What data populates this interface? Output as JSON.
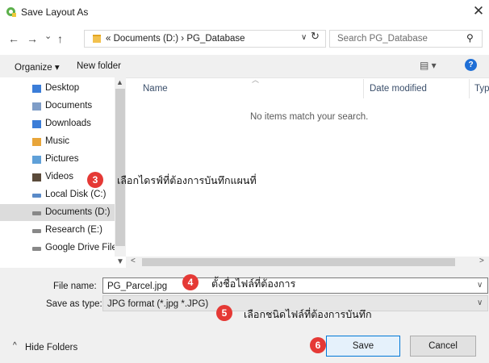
{
  "window": {
    "title": "Save Layout As",
    "close_glyph": "✕"
  },
  "nav": {
    "back": "←",
    "forward": "→",
    "recent": "⌄",
    "up": "↑"
  },
  "address": {
    "path": "«  Documents (D:)  ›  PG_Database",
    "dropdown": "∨",
    "refresh": "↻"
  },
  "search": {
    "placeholder": "Search PG_Database",
    "icon": "⚲"
  },
  "toolbar": {
    "organize": "Organize ▾",
    "new_folder": "New folder",
    "view_glyph": "▤ ▾",
    "help": "?"
  },
  "sidebar": {
    "items": [
      {
        "label": "Desktop",
        "icon": "folder-icon",
        "color": "#3b7dd8"
      },
      {
        "label": "Documents",
        "icon": "documents-icon",
        "color": "#7f9dc7"
      },
      {
        "label": "Downloads",
        "icon": "downloads-icon",
        "color": "#3b7dd8"
      },
      {
        "label": "Music",
        "icon": "music-icon",
        "color": "#e8a53a"
      },
      {
        "label": "Pictures",
        "icon": "pictures-icon",
        "color": "#5fa0d8"
      },
      {
        "label": "Videos",
        "icon": "videos-icon",
        "color": "#5a4a3a"
      },
      {
        "label": "Local Disk (C:)",
        "icon": "drive-icon",
        "color": "#5a8ac8"
      },
      {
        "label": "Documents (D:)",
        "icon": "drive-icon",
        "color": "#888888"
      },
      {
        "label": "Research (E:)",
        "icon": "drive-icon",
        "color": "#888888"
      },
      {
        "label": "Google Drive File",
        "icon": "drive-icon",
        "color": "#888888"
      }
    ],
    "selected": "Documents (D:)"
  },
  "columns": {
    "name": "Name",
    "date": "Date modified",
    "type": "Typ"
  },
  "empty_message": "No items match your search.",
  "form": {
    "file_name_label": "File name:",
    "file_name_value": "PG_Parcel.jpg",
    "save_type_label": "Save as type:",
    "save_type_value": "JPG format (*.jpg *.JPG)"
  },
  "footer": {
    "hide_folders": "Hide Folders",
    "save": "Save",
    "cancel": "Cancel"
  },
  "annotations": [
    {
      "number": "3",
      "text": "เลือกไดรฟ์ที่ต้องการบันทึกแผนที่"
    },
    {
      "number": "4",
      "text": "ตั้งชื่อไฟล์ที่ต้องการ"
    },
    {
      "number": "5",
      "text": "เลือกชนิดไฟล์ที่ต้องการบันทึก"
    },
    {
      "number": "6",
      "text": ""
    }
  ],
  "colors": {
    "accent": "#0078d7",
    "marker": "#e53935",
    "qgis": "#5cb04b"
  }
}
